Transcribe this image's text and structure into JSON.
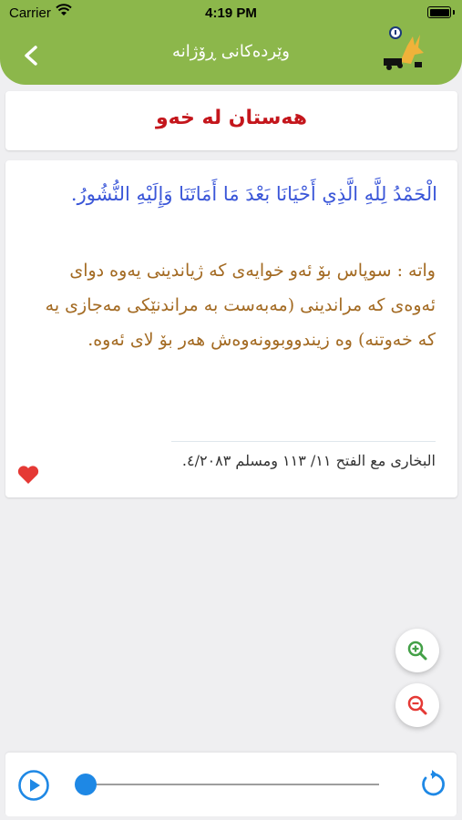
{
  "status_bar": {
    "carrier": "Carrier",
    "time": "4:19 PM"
  },
  "header": {
    "title": "وێردەکانی ڕۆژانە",
    "back_icon": "chevron-left-icon",
    "logo": "app-logo-icon"
  },
  "page": {
    "section_title": "هەستان لە خەو",
    "arabic": "الْحَمْدُ لِلَّهِ الَّذِي أَحْيَانَا بَعْدَ مَا أَمَاتَنَا وَإِلَيْهِ النُّشُورُ.",
    "translation": "واتە : سوپاس بۆ ئەو خوایەی کە ژیاندینی یەوە دوای ئەوەی کە مراندینی (مەبەست بە مراندنێکی مەجازی یە کە خەوتنە) وە زیندووبوونەوەش هەر بۆ لای ئەوە.",
    "source": "البخاری مع الفتح ١١/ ١١٣ ومسلم ٤/٢٠٨٣."
  },
  "actions": {
    "favorite_icon": "heart-icon",
    "zoom_in_icon": "zoom-in-icon",
    "zoom_out_icon": "zoom-out-icon"
  },
  "player": {
    "play_icon": "play-icon",
    "replay_icon": "replay-icon",
    "progress": 0
  },
  "colors": {
    "header_bg": "#8cb74b",
    "title": "#c4161c",
    "arabic": "#3a56d8",
    "translation": "#a36a22",
    "accent_blue": "#1e88e5",
    "favorite": "#e53935",
    "zoom_in": "#43a047",
    "zoom_out": "#e53935"
  }
}
